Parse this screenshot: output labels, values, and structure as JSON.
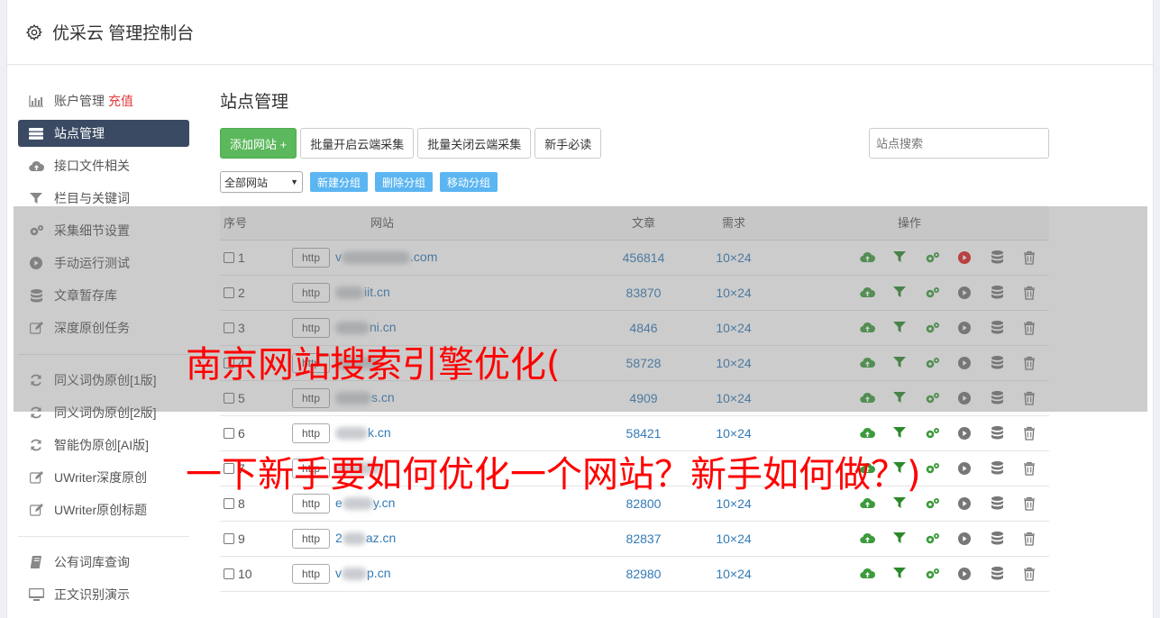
{
  "app": {
    "title": "优采云 管理控制台"
  },
  "sidebar": {
    "items": [
      {
        "label": "账户管理",
        "extra": "充值",
        "icon": "bar-chart-icon"
      },
      {
        "label": "站点管理",
        "icon": "server-icon",
        "active": true
      },
      {
        "label": "接口文件相关",
        "icon": "cloud-upload-icon"
      },
      {
        "label": "栏目与关键词",
        "icon": "filter-icon"
      },
      {
        "label": "采集细节设置",
        "icon": "cogs-icon"
      },
      {
        "label": "手动运行测试",
        "icon": "play-icon"
      },
      {
        "label": "文章暂存库",
        "icon": "database-icon"
      },
      {
        "label": "深度原创任务",
        "icon": "edit-icon"
      }
    ],
    "items2": [
      {
        "label": "同义词伪原创[1版]",
        "icon": "refresh-icon"
      },
      {
        "label": "同义词伪原创[2版]",
        "icon": "refresh-icon"
      },
      {
        "label": "智能伪原创[AI版]",
        "icon": "refresh-icon"
      },
      {
        "label": "UWriter深度原创",
        "icon": "edit-icon"
      },
      {
        "label": "UWriter原创标题",
        "icon": "edit-icon"
      }
    ],
    "items3": [
      {
        "label": "公有词库查询",
        "icon": "book-icon"
      },
      {
        "label": "正文识别演示",
        "icon": "monitor-icon"
      }
    ]
  },
  "main": {
    "title": "站点管理",
    "toolbar": {
      "add_label": "添加网站 +",
      "batch_open_label": "批量开启云端采集",
      "batch_close_label": "批量关闭云端采集",
      "newbie_label": "新手必读",
      "search_placeholder": "站点搜索"
    },
    "group_select": "全部网站",
    "new_group": "新建分组",
    "delete_group": "删除分组",
    "move_group": "移动分组"
  },
  "table": {
    "headers": {
      "idx": "序号",
      "site": "网站",
      "articles": "文章",
      "demand": "需求",
      "ops": "操作"
    },
    "http_label": "http",
    "rows": [
      {
        "idx": "1",
        "pre": "v",
        "suffix": ".com",
        "blur": 76,
        "articles": "456814",
        "demand": "10×24",
        "running": true
      },
      {
        "idx": "2",
        "pre": "",
        "suffix": "iit.cn",
        "blur": 32,
        "articles": "83870",
        "demand": "10×24",
        "running": false
      },
      {
        "idx": "3",
        "pre": "",
        "suffix": "ni.cn",
        "blur": 38,
        "articles": "4846",
        "demand": "10×24",
        "running": false
      },
      {
        "idx": "4",
        "pre": "",
        "suffix": "",
        "blur": 50,
        "articles": "58728",
        "demand": "10×24",
        "running": false
      },
      {
        "idx": "5",
        "pre": "",
        "suffix": "s.cn",
        "blur": 40,
        "articles": "4909",
        "demand": "10×24",
        "running": false
      },
      {
        "idx": "6",
        "pre": "",
        "suffix": "k.cn",
        "blur": 36,
        "articles": "58421",
        "demand": "10×24",
        "running": false
      },
      {
        "idx": "7",
        "pre": "",
        "suffix": "",
        "blur": 50,
        "articles": "",
        "demand": "",
        "running": false
      },
      {
        "idx": "8",
        "pre": "e",
        "suffix": "y.cn",
        "blur": 34,
        "articles": "82800",
        "demand": "10×24",
        "running": false
      },
      {
        "idx": "9",
        "pre": "2",
        "suffix": "az.cn",
        "blur": 26,
        "articles": "82837",
        "demand": "10×24",
        "running": false
      },
      {
        "idx": "10",
        "pre": "v",
        "suffix": "p.cn",
        "blur": 28,
        "articles": "82980",
        "demand": "10×24",
        "running": false
      }
    ]
  },
  "overlay": {
    "line1": "南京网站搜索引擎优化(",
    "line2": "一下新手要如何优化一个网站？新手如何做？)"
  },
  "colors": {
    "accent": "#3a4a63",
    "green": "#5cb85c",
    "link": "#337ab7",
    "overlay_text": "#ff0000"
  }
}
